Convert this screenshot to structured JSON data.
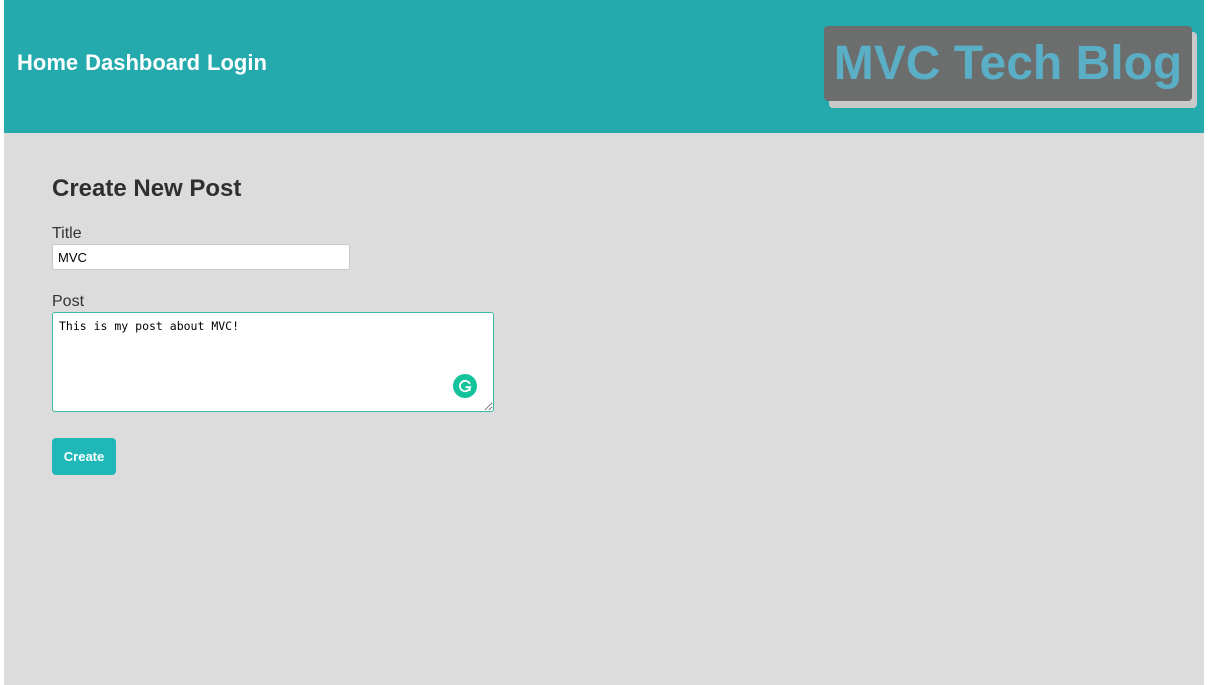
{
  "nav": {
    "home": "Home",
    "dashboard": "Dashboard",
    "login": "Login"
  },
  "brand": {
    "title": "MVC Tech Blog"
  },
  "form": {
    "heading": "Create New Post",
    "title_label": "Title",
    "title_value": "MVC",
    "post_label": "Post",
    "post_value": "This is my post about MVC!",
    "submit_label": "Create"
  },
  "icons": {
    "grammar_icon": "grammarly-g-icon"
  },
  "colors": {
    "header": "#24aaad",
    "background": "#dcdcdc",
    "brand_box": "#6b6e6d",
    "brand_text": "#5aaec6",
    "button": "#1fb7b8",
    "textarea_border": "#3fb8a0"
  }
}
